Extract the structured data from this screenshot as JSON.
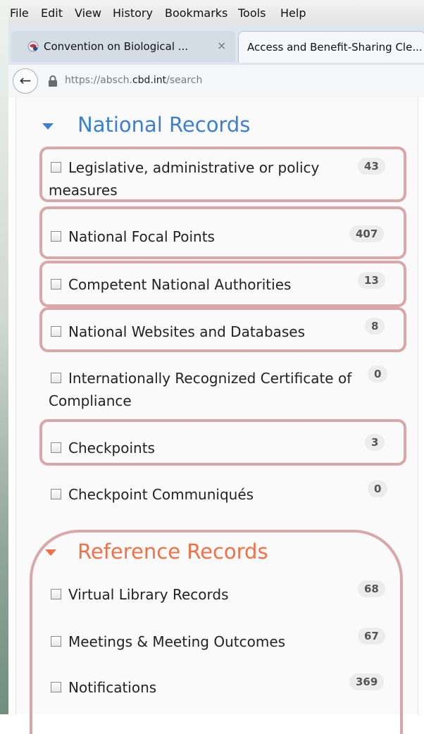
{
  "menu": [
    "File",
    "Edit",
    "View",
    "History",
    "Bookmarks",
    "Tools",
    "Help"
  ],
  "tabs": [
    {
      "label": "Convention on Biological ...",
      "close": "×"
    },
    {
      "label": "Access and Benefit-Sharing Cle..."
    }
  ],
  "address": {
    "prefix": "https://absch.",
    "domain": "cbd.int",
    "path": "/search"
  },
  "national": {
    "title": "National Records",
    "color": "#3a7fd0",
    "items": [
      {
        "label": "Legislative, administrative or policy measures",
        "count": "43"
      },
      {
        "label": "National Focal Points",
        "count": "407"
      },
      {
        "label": "Competent National Authorities",
        "count": "13"
      },
      {
        "label": "National Websites and Databases",
        "count": "8"
      },
      {
        "label": "Internationally Recognized Certificate of Compliance",
        "count": "0"
      },
      {
        "label": "Checkpoints",
        "count": "3"
      },
      {
        "label": "Checkpoint Communiqués",
        "count": "0"
      }
    ]
  },
  "reference": {
    "title": "Reference Records",
    "color": "#f07048",
    "items": [
      {
        "label": "Virtual Library Records",
        "count": "68"
      },
      {
        "label": "Meetings & Meeting Outcomes",
        "count": "67"
      },
      {
        "label": "Notifications",
        "count": "369"
      }
    ]
  },
  "highlight_color": "#d9a7a7"
}
